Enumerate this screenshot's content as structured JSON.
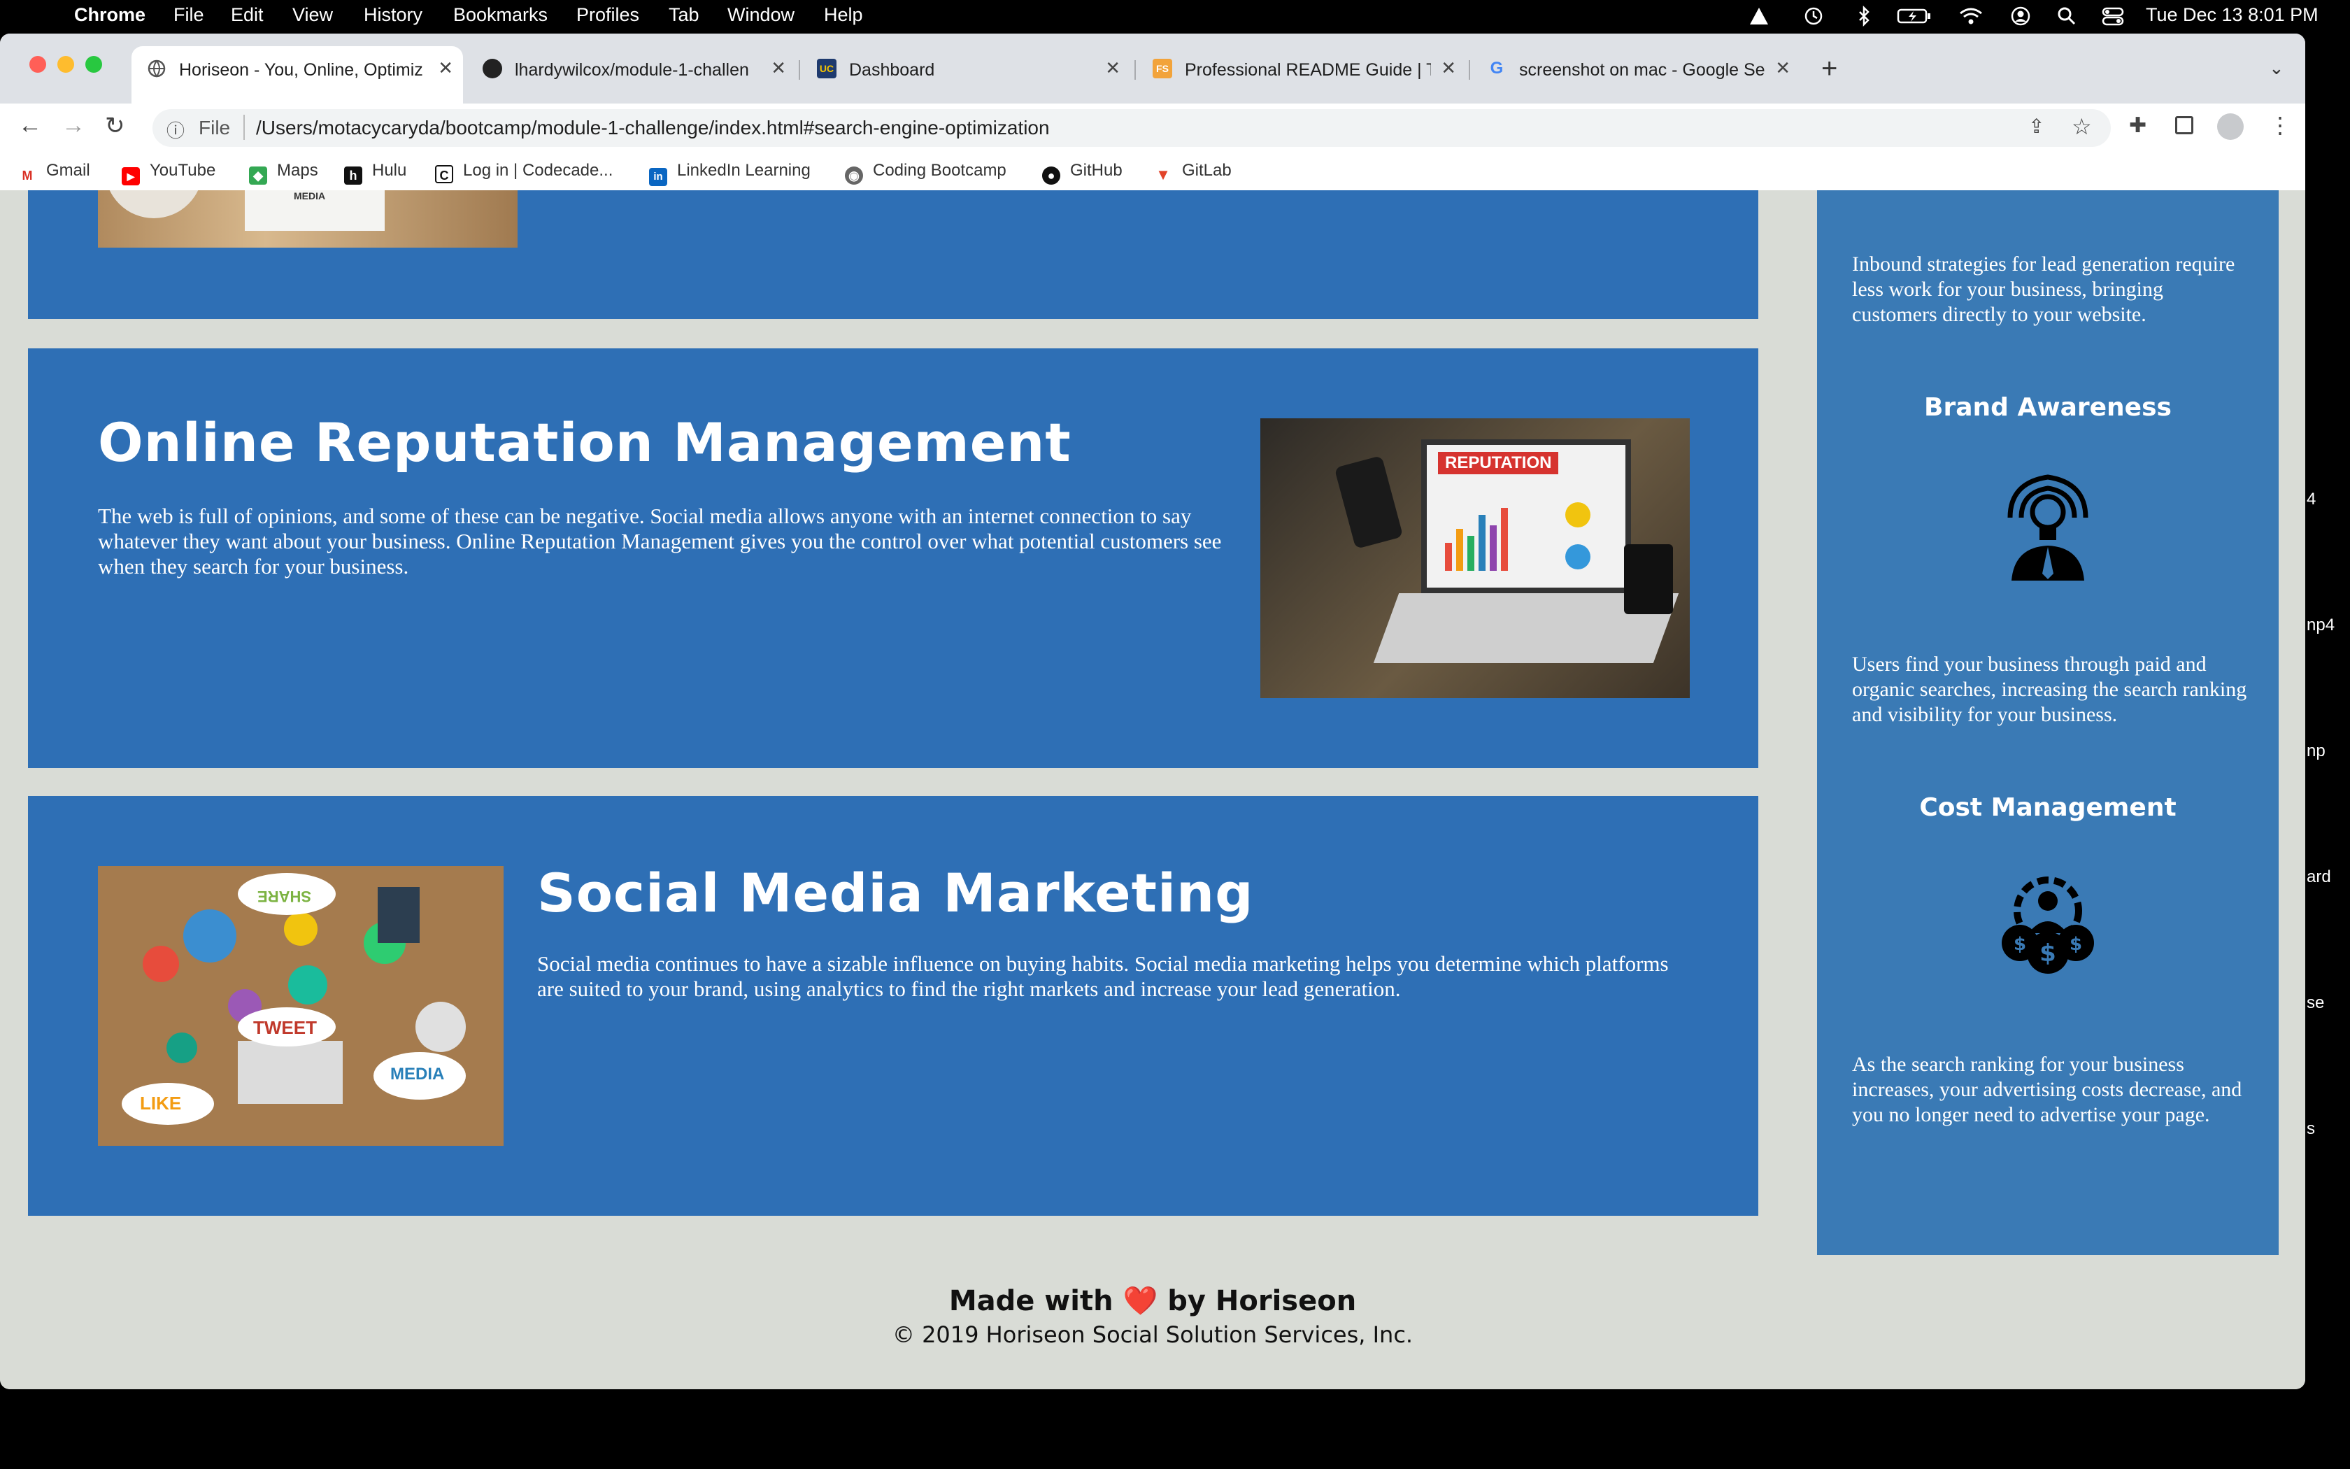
{
  "menubar": {
    "app": "Chrome",
    "menus": [
      "File",
      "Edit",
      "View",
      "History",
      "Bookmarks",
      "Profiles",
      "Tab",
      "Window",
      "Help"
    ],
    "clock": "Tue Dec 13  8:01 PM",
    "status_icons": [
      "warning-icon",
      "time-machine-icon",
      "bluetooth-icon",
      "battery-icon",
      "wifi-icon",
      "user-icon",
      "search-icon",
      "control-center-icon"
    ]
  },
  "tabs": [
    {
      "title": "Horiseon - You, Online, Optimiz",
      "icon": "globe-icon",
      "active": true
    },
    {
      "title": "lhardywilcox/module-1-challen",
      "icon": "github-icon",
      "active": false
    },
    {
      "title": "Dashboard",
      "icon": "ucb-icon",
      "active": false
    },
    {
      "title": "Professional README Guide | T",
      "icon": "fs-icon",
      "active": false
    },
    {
      "title": "screenshot on mac - Google Se",
      "icon": "google-icon",
      "active": false
    }
  ],
  "toolbar": {
    "scheme_label": "File",
    "url": "/Users/motacycaryda/bootcamp/module-1-challenge/index.html#search-engine-optimization"
  },
  "bookmarks": [
    {
      "label": "Gmail",
      "icon": "gmail-icon",
      "color": "#d93025",
      "glyph": "M"
    },
    {
      "label": "YouTube",
      "icon": "youtube-icon",
      "color": "#ff0000",
      "glyph": "▶"
    },
    {
      "label": "Maps",
      "icon": "maps-icon",
      "color": "#34a853",
      "glyph": "◆"
    },
    {
      "label": "Hulu",
      "icon": "hulu-icon",
      "color": "#111111",
      "glyph": "h"
    },
    {
      "label": "Log in | Codecade...",
      "icon": "codecademy-icon",
      "color": "#ffffff",
      "glyph": "C"
    },
    {
      "label": "LinkedIn Learning",
      "icon": "linkedin-icon",
      "color": "#0a66c2",
      "glyph": "in"
    },
    {
      "label": "Coding Bootcamp",
      "icon": "globe-icon",
      "color": "#555555",
      "glyph": "◉"
    },
    {
      "label": "GitHub",
      "icon": "github-icon",
      "color": "#111111",
      "glyph": "●"
    },
    {
      "label": "GitLab",
      "icon": "gitlab-icon",
      "color": "#e24329",
      "glyph": "▼"
    }
  ],
  "sections": {
    "top_image_caption": "MEDIA",
    "reputation": {
      "title": "Online Reputation Management",
      "body": "The web is full of opinions, and some of these can be negative. Social media allows anyone with an internet connection to say whatever they want about your business. Online Reputation Management gives you the control over what potential customers see when they search for your business.",
      "image_label": "REPUTATION"
    },
    "social": {
      "title": "Social Media Marketing",
      "body": "Social media continues to have a sizable influence on buying habits. Social media marketing helps you determine which platforms are suited to your brand, using analytics to find the right markets and increase your lead generation.",
      "bubble_labels": [
        "SHARE",
        "TWEET",
        "LIKE",
        "MEDIA"
      ]
    }
  },
  "aside": {
    "lead_text": "Inbound strategies for lead generation require less work for your business, bringing customers directly to your website.",
    "brand_title": "Brand Awareness",
    "brand_text": "Users find your business through paid and organic searches, increasing the search ranking and visibility for your business.",
    "cost_title": "Cost Management",
    "cost_text": "As the search ranking for your business increases, your advertising costs decrease, and you no longer need to advertise your page."
  },
  "footer": {
    "made_prefix": "Made with",
    "heart": "❤️",
    "made_suffix": "by Horiseon",
    "copyright": "© 2019 Horiseon Social Solution Services, Inc."
  },
  "desktop_edge_labels": [
    "4",
    "np4",
    "np",
    "ard",
    "se",
    "s"
  ],
  "colors": {
    "card_blue": "#2e6fb5",
    "aside_blue": "#3a7ab5",
    "page_bg": "#d9dcd6"
  }
}
